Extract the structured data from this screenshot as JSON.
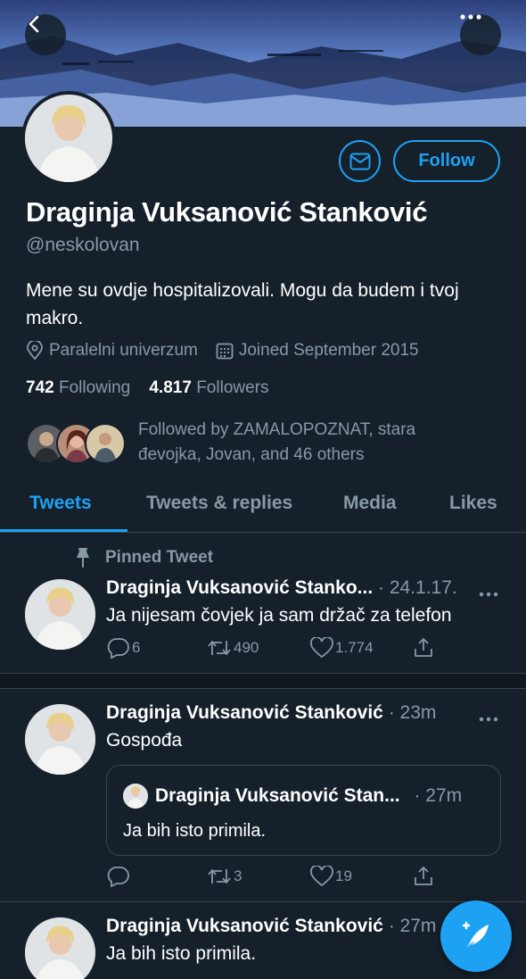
{
  "profile": {
    "name": "Draginja Vuksanović Stanković",
    "handle": "@neskolovan",
    "bio": "Mene su ovdje hospitalizovali. Mogu da budem i tvoj makro.",
    "location": "Paralelni univerzum",
    "joined": "Joined September 2015",
    "following_count": "742",
    "following_label": "Following",
    "followers_count": "4.817",
    "followers_label": "Followers",
    "followed_by": "Followed by ZAMALOPOZNAT, stara đevojka, Jovan, and 46 others",
    "follow_button": "Follow"
  },
  "tabs": [
    {
      "label": "Tweets",
      "active": true
    },
    {
      "label": "Tweets & replies",
      "active": false
    },
    {
      "label": "Media",
      "active": false
    },
    {
      "label": "Likes",
      "active": false
    }
  ],
  "tweets": [
    {
      "pinned_label": "Pinned Tweet",
      "author": "Draginja Vuksanović Stanko...",
      "time": "· 24.1.17.",
      "text": "Ja nijesam čovjek ja sam držač za telefon",
      "replies": "6",
      "retweets": "490",
      "likes": "1.774"
    },
    {
      "author": "Draginja Vuksanović Stanković",
      "time": "· 23m",
      "text": "Gospođa",
      "quote": {
        "author": "Draginja Vuksanović Stan...",
        "time": "· 27m",
        "text": "Ja bih isto primila."
      },
      "replies": "",
      "retweets": "3",
      "likes": "19"
    },
    {
      "author": "Draginja Vuksanović Stanković",
      "time": "· 27m",
      "text": "Ja bih isto primila."
    }
  ],
  "icons": {
    "back": "chevron-left-icon",
    "more": "more-dots-icon",
    "message": "envelope-icon",
    "location": "location-pin-icon",
    "calendar": "calendar-icon",
    "pin": "pin-icon",
    "reply": "reply-icon",
    "retweet": "retweet-icon",
    "like": "heart-icon",
    "share": "share-icon",
    "compose": "compose-feather-icon"
  },
  "colors": {
    "background": "#15202b",
    "accent": "#1da1f2",
    "muted": "#8899a6",
    "divider": "#38444d"
  }
}
